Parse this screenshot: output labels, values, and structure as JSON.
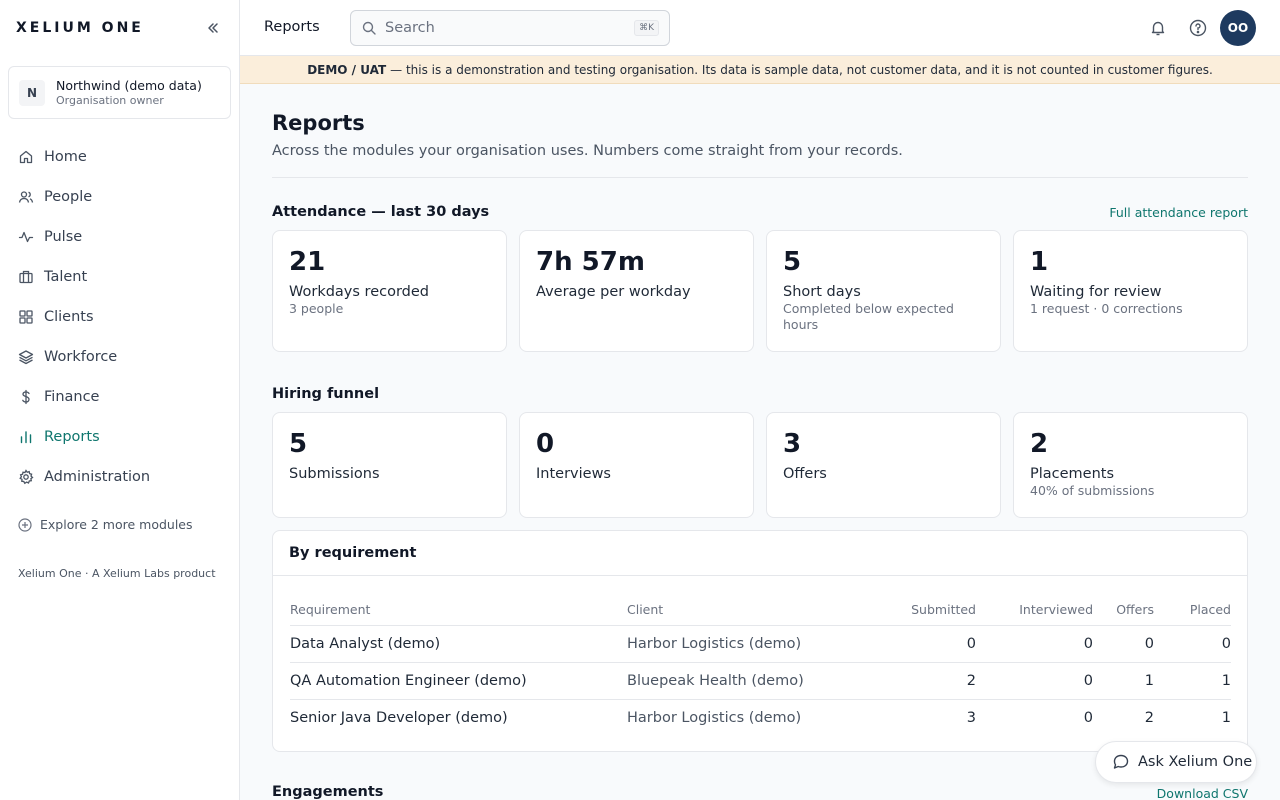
{
  "brand": "XELIUM ONE",
  "org": {
    "initial": "N",
    "name": "Northwind (demo data)",
    "role": "Organisation owner"
  },
  "nav": [
    {
      "label": "Home",
      "icon": "home-icon"
    },
    {
      "label": "People",
      "icon": "people-icon"
    },
    {
      "label": "Pulse",
      "icon": "pulse-icon"
    },
    {
      "label": "Talent",
      "icon": "briefcase-icon"
    },
    {
      "label": "Clients",
      "icon": "grid-icon"
    },
    {
      "label": "Workforce",
      "icon": "layers-icon"
    },
    {
      "label": "Finance",
      "icon": "dollar-icon"
    },
    {
      "label": "Reports",
      "icon": "bar-chart-icon",
      "active": true
    },
    {
      "label": "Administration",
      "icon": "gear-icon"
    }
  ],
  "explore": "Explore 2 more modules",
  "footer_note": "Xelium One · A Xelium Labs product",
  "topbar": {
    "breadcrumb": "Reports",
    "search_placeholder": "Search",
    "shortcut": "⌘K",
    "avatar_initials": "OO"
  },
  "banner": {
    "tag": "DEMO / UAT",
    "text": "— this is a demonstration and testing organisation. Its data is sample data, not customer data, and it is not counted in customer figures."
  },
  "page": {
    "title": "Reports",
    "subtitle": "Across the modules your organisation uses. Numbers come straight from your records."
  },
  "attendance": {
    "title": "Attendance — last 30 days",
    "link": "Full attendance report",
    "cards": [
      {
        "value": "21",
        "label": "Workdays recorded",
        "sub": "3 people"
      },
      {
        "value": "7h 57m",
        "label": "Average per workday",
        "sub": ""
      },
      {
        "value": "5",
        "label": "Short days",
        "sub": "Completed below expected hours"
      },
      {
        "value": "1",
        "label": "Waiting for review",
        "sub": "1 request · 0 corrections"
      }
    ]
  },
  "hiring": {
    "title": "Hiring funnel",
    "cards": [
      {
        "value": "5",
        "label": "Submissions",
        "sub": ""
      },
      {
        "value": "0",
        "label": "Interviews",
        "sub": ""
      },
      {
        "value": "3",
        "label": "Offers",
        "sub": ""
      },
      {
        "value": "2",
        "label": "Placements",
        "sub": "40% of submissions"
      }
    ]
  },
  "requirements": {
    "title": "By requirement",
    "columns": [
      "Requirement",
      "Client",
      "Submitted",
      "Interviewed",
      "Offers",
      "Placed"
    ],
    "rows": [
      [
        "Data Analyst (demo)",
        "Harbor Logistics (demo)",
        "0",
        "0",
        "0",
        "0"
      ],
      [
        "QA Automation Engineer (demo)",
        "Bluepeak Health (demo)",
        "2",
        "0",
        "1",
        "1"
      ],
      [
        "Senior Java Developer (demo)",
        "Harbor Logistics (demo)",
        "3",
        "0",
        "2",
        "1"
      ]
    ]
  },
  "engagements": {
    "title": "Engagements",
    "link": "Download CSV"
  },
  "ask_button": "Ask Xelium One",
  "colors": {
    "accent": "#0f766e",
    "banner_bg": "#fbeedb",
    "avatar_bg": "#1e3a5f"
  }
}
